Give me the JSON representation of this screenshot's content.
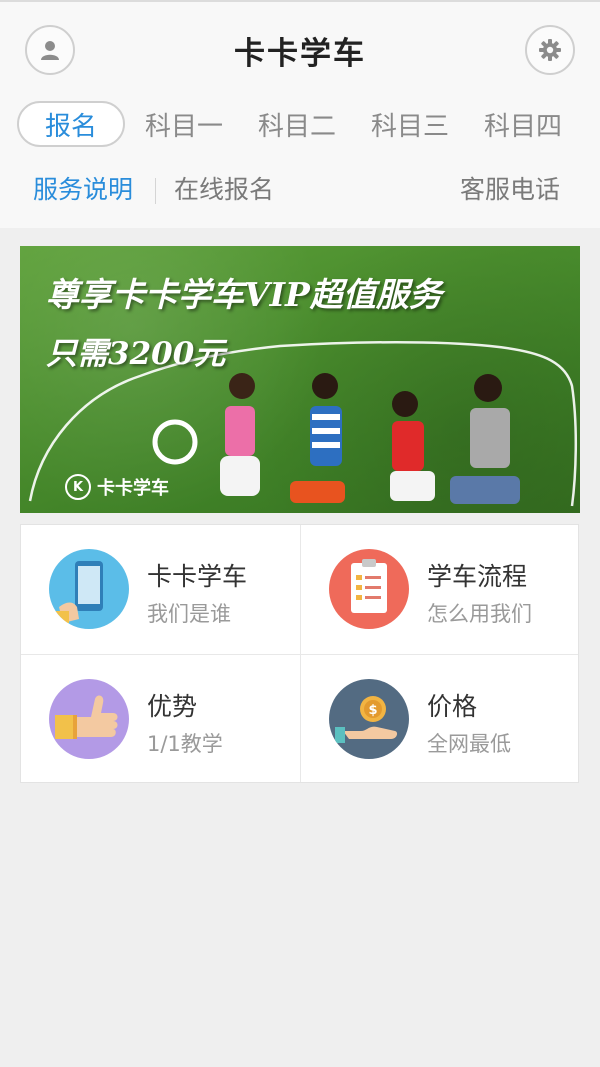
{
  "header": {
    "title": "卡卡学车",
    "profile_icon": "user-icon",
    "settings_icon": "gear-icon"
  },
  "tabs": [
    {
      "label": "报名",
      "active": true
    },
    {
      "label": "科目一",
      "active": false
    },
    {
      "label": "科目二",
      "active": false
    },
    {
      "label": "科目三",
      "active": false
    },
    {
      "label": "科目四",
      "active": false
    }
  ],
  "subnav": {
    "service_desc": "服务说明",
    "online_signup": "在线报名",
    "customer_phone": "客服电话"
  },
  "banner": {
    "headline": "尊享卡卡学车VIP超值服务",
    "price": "只需3200元",
    "logo_text": "卡卡学车"
  },
  "features": [
    {
      "title": "卡卡学车",
      "subtitle": "我们是谁",
      "icon": "phone-icon",
      "color": "#5bbde8"
    },
    {
      "title": "学车流程",
      "subtitle": "怎么用我们",
      "icon": "clipboard-icon",
      "color": "#ef6a5a"
    },
    {
      "title": "优势",
      "subtitle": "1/1教学",
      "icon": "thumbs-up-icon",
      "color": "#b39ae6"
    },
    {
      "title": "价格",
      "subtitle": "全网最低",
      "icon": "money-hand-icon",
      "color": "#536b82"
    }
  ],
  "colors": {
    "accent": "#2a8ddb",
    "background": "#efefef"
  }
}
